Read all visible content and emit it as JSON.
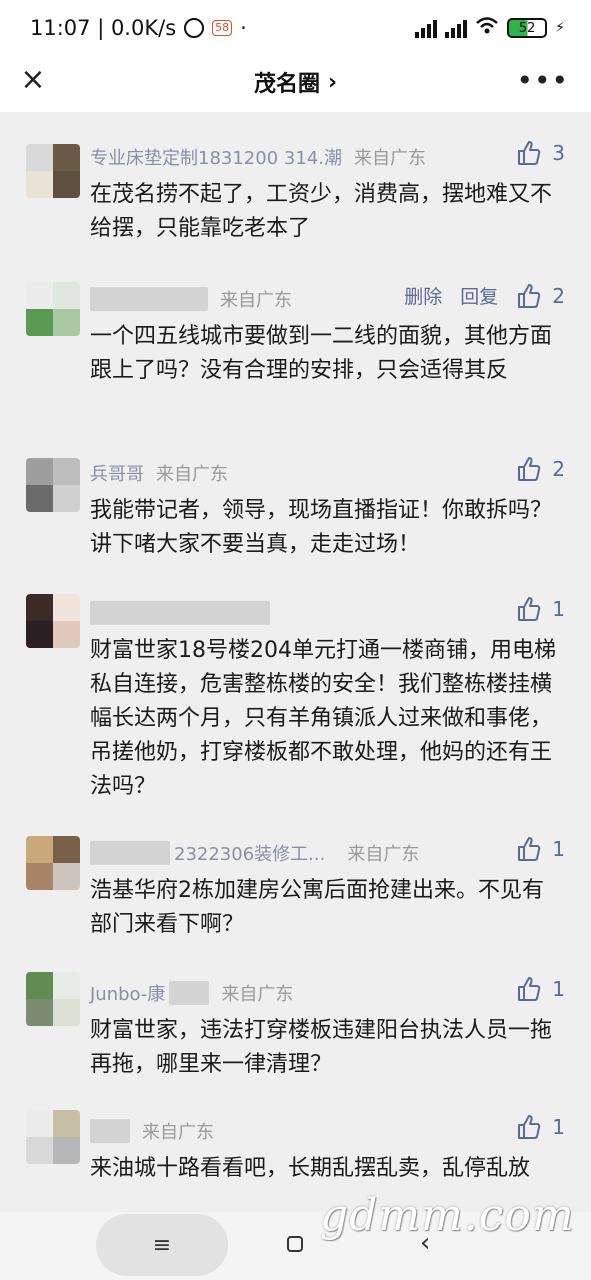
{
  "status_bar": {
    "time_speed": "11:07 | 0.0K/s",
    "badge": "58",
    "battery": "52"
  },
  "header": {
    "title": "茂名圈",
    "title_chevron": "›",
    "close_icon": "×",
    "more_icon": "•••"
  },
  "comments": [
    {
      "name": "专业床垫定制1831200 314.潮",
      "location": "来自广东",
      "likes": "3",
      "text": "在茂名捞不起了，工资少，消费高，摆地难又不给摆，只能靠吃老本了",
      "avatar_colors": [
        "#d9d9d9",
        "#6b5a45",
        "#e8e3d6",
        "#5e5040"
      ]
    },
    {
      "name": "",
      "location": "来自广东",
      "delete_label": "删除",
      "reply_label": "回复",
      "likes": "2",
      "text": "一个四五线城市要做到一二线的面貌，其他方面跟上了吗？没有合理的安排，只会适得其反",
      "avatar_colors": [
        "#ececec",
        "#dfe8df",
        "#5a9a55",
        "#a8c9a2"
      ]
    },
    {
      "name": "兵哥哥",
      "location": "来自广东",
      "likes": "2",
      "text": "我能带记者，领导，现场直播指证！你敢拆吗？讲下啫大家不要当真，走走过场！",
      "avatar_colors": [
        "#9e9e9e",
        "#bdbdbd",
        "#6b6b6b",
        "#d0d0d0"
      ]
    },
    {
      "name": "",
      "location": "",
      "likes": "1",
      "text": "财富世家18号楼204单元打通一楼商铺，用电梯私自连接，危害整栋楼的安全！我们整栋楼挂横幅长达两个月，只有羊角镇派人过来做和事佬，吊搓他奶，打穿楼板都不敢处理，他妈的还有王法吗？",
      "avatar_colors": [
        "#3a2a28",
        "#f1e4dc",
        "#2a1f22",
        "#e0c8bc"
      ]
    },
    {
      "name": "2322306装修工...",
      "location": "来自广东",
      "likes": "1",
      "text": "浩基华府2栋加建房公寓后面抢建出来。不见有部门来看下啊？",
      "avatar_colors": [
        "#c9a87a",
        "#7a6048",
        "#a88468",
        "#cfc4bb"
      ]
    },
    {
      "name": "Junbo-康",
      "location": "来自广东",
      "likes": "1",
      "text": "财富世家，违法打穿楼板违建阳台执法人员一拖再拖，哪里来一律清理？",
      "avatar_colors": [
        "#5f8c52",
        "#e8ece6",
        "#7c8a72",
        "#d9e0d4"
      ]
    },
    {
      "name": "",
      "location": "来自广东",
      "likes": "1",
      "text": "来油城十路看看吧，长期乱摆乱卖，乱停乱放",
      "avatar_colors": [
        "#ececec",
        "#c8bfa6",
        "#d9d9d9",
        "#b7b7b7"
      ]
    }
  ],
  "nav": {
    "menu_icon": "≡",
    "back_icon": "‹"
  },
  "watermark": "gdmm.com"
}
